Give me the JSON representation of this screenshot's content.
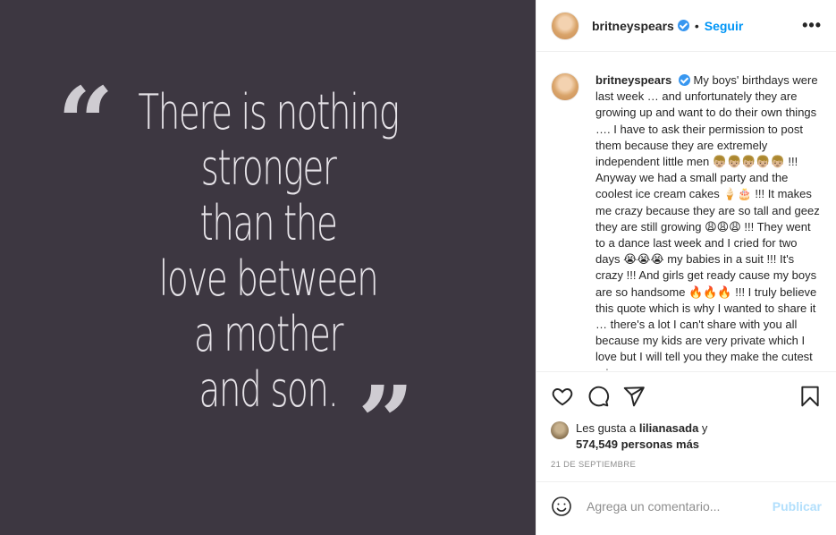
{
  "post": {
    "quote_lines": [
      "There is nothing",
      "stronger",
      "than the",
      "love between",
      "a mother",
      "and son."
    ],
    "open_quote": "“",
    "close_quote": "”",
    "background_color": "#3d3741"
  },
  "header": {
    "username": "britneyspears",
    "verified": true,
    "separator": "•",
    "follow_label": "Seguir",
    "more_icon": "more-horizontal-icon",
    "more_label": "•••"
  },
  "caption": {
    "username": "britneyspears",
    "text": "My boys' birthdays were last week … and unfortunately they are growing up and want to do their own things …. I have to ask their permission to post them because they are extremely independent little men 👦🏼👦🏼👦🏼👦🏼👦🏼 !!! Anyway we had a small party and the coolest ice cream cakes 🍦🎂 !!! It makes me crazy because they are so tall and geez they are still growing 😩😩😩 !!! They went to a dance last week and I cried for two days 😭😭😭 my babies in a suit !!! It's crazy !!! And girls get ready cause my boys are so handsome 🔥🔥🔥 !!! I truly believe this quote which is why I wanted to share it … there's a lot I can't share with you all because my kids are very private which I love but I will tell you they make the cutest grin …"
  },
  "actions": {
    "like_icon": "heart-icon",
    "comment_icon": "comment-icon",
    "share_icon": "send-icon",
    "save_icon": "bookmark-icon"
  },
  "likes": {
    "prefix": "Les gusta a ",
    "user": "lilianasada",
    "middle": " y",
    "count": "574,549 personas más"
  },
  "date": "21 DE SEPTIEMBRE",
  "comment": {
    "placeholder": "Agrega un comentario...",
    "post_label": "Publicar",
    "emoji_icon": "smiley-icon"
  }
}
